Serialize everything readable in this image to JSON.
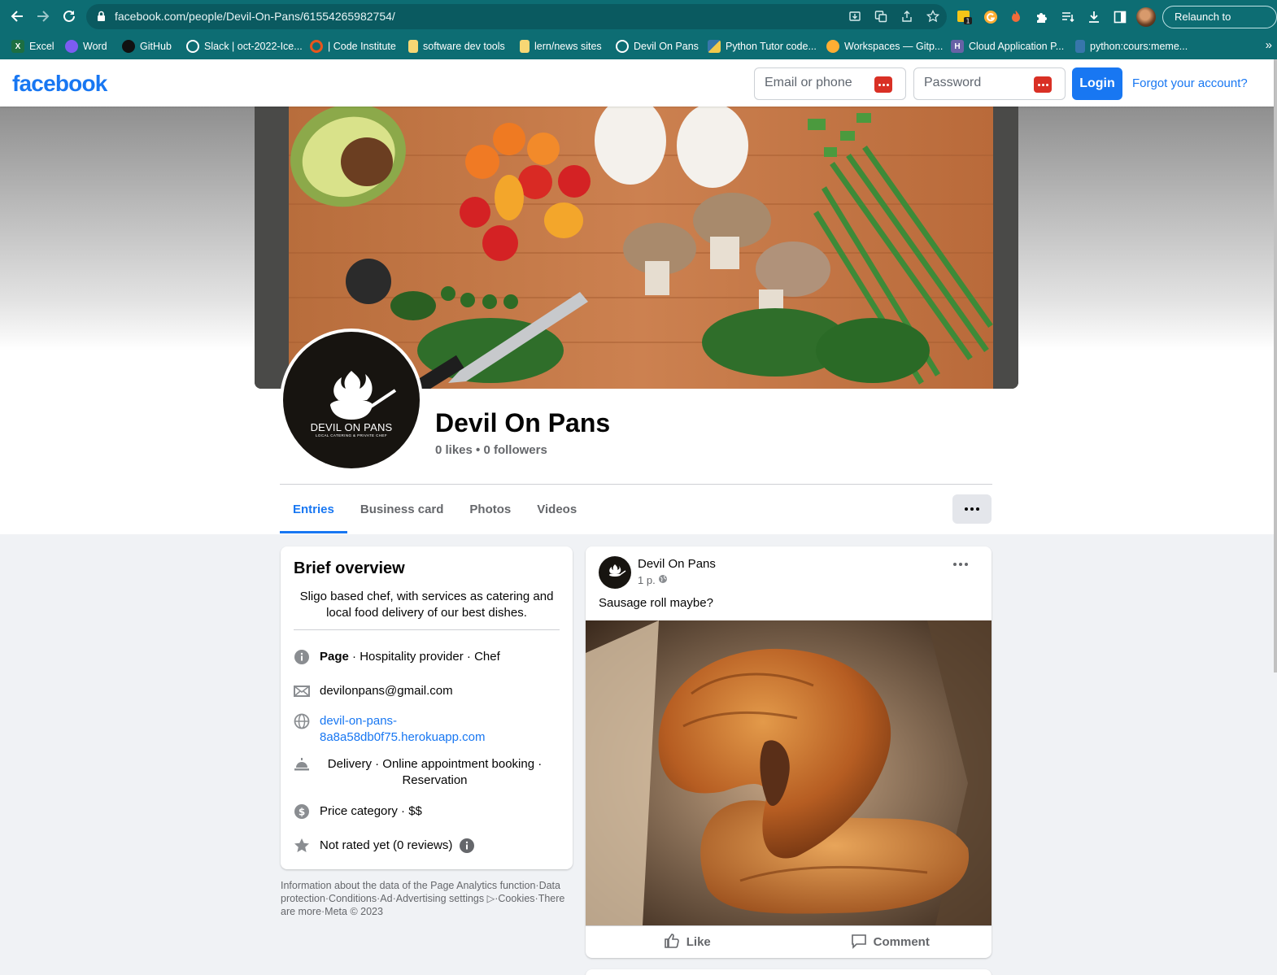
{
  "browser": {
    "url": "facebook.com/people/Devil-On-Pans/61554265982754/",
    "relaunch_label": "Relaunch to update",
    "extension_badge": "1",
    "bookmarks": [
      {
        "label": "Excel",
        "icon": "excel-icon",
        "color": "#1d6f42"
      },
      {
        "label": "Word",
        "icon": "word-icon",
        "color": "#7c5cf2"
      },
      {
        "label": "GitHub",
        "icon": "github-icon",
        "color": "#111111"
      },
      {
        "label": "Slack | oct-2022-Ice...",
        "icon": "globe-icon",
        "color": "#ffffff"
      },
      {
        "label": "| Code Institute",
        "icon": "code-institute-icon",
        "color": "#e8561c"
      },
      {
        "label": "software dev tools",
        "icon": "folder-icon",
        "color": "#f7d774"
      },
      {
        "label": "lern/news sites",
        "icon": "folder-icon",
        "color": "#f7d774"
      },
      {
        "label": "Devil On Pans",
        "icon": "globe-icon",
        "color": "#ffffff"
      },
      {
        "label": "Python Tutor code...",
        "icon": "python-icon",
        "color": "#f2c94c"
      },
      {
        "label": "Workspaces — Gitp...",
        "icon": "gitpod-icon",
        "color": "#ffae33"
      },
      {
        "label": "Cloud Application P...",
        "icon": "heroku-icon",
        "color": "#6762a6"
      },
      {
        "label": "python:cours:meme...",
        "icon": "python-doc-icon",
        "color": "#3776ab"
      }
    ],
    "more_glyph": "»"
  },
  "header": {
    "logo": "facebook",
    "email_placeholder": "Email or phone",
    "password_placeholder": "Password",
    "login_label": "Login",
    "forgot_label": "Forgot your account?"
  },
  "profile": {
    "name": "Devil On Pans",
    "stats": "0 likes • 0 followers",
    "logo_line1": "DEVIL ON PANS",
    "logo_line2": "LOCAL CATERING & PRIVATE CHEF",
    "tabs": [
      {
        "label": "Entries",
        "active": true
      },
      {
        "label": "Business card",
        "active": false
      },
      {
        "label": "Photos",
        "active": false
      },
      {
        "label": "Videos",
        "active": false
      }
    ]
  },
  "overview": {
    "title": "Brief overview",
    "bio": "Sligo based chef, with services as catering and local food delivery of our best dishes.",
    "page_bold": "Page",
    "page_rest": " · Hospitality provider · Chef",
    "email": "devilonpans@gmail.com",
    "website_line1": "devil-on-pans-",
    "website_line2": "8a8a58db0f75.herokuapp.com",
    "services": "Delivery · Online appointment booking · Reservation",
    "price": "Price category · $$",
    "rating": "Not rated yet (0 reviews)"
  },
  "footer": "Information about the data of the Page Analytics function·Data protection·Conditions·Ad·Advertising settings ▷·Cookies·There are more·Meta © 2023",
  "post": {
    "author": "Devil On Pans",
    "time": "1 p.",
    "text": "Sausage roll maybe?",
    "like_label": "Like",
    "comment_label": "Comment"
  },
  "colors": {
    "brand": "#1877f2",
    "chrome": "#0d6d73",
    "password_manager": "#d93025"
  }
}
